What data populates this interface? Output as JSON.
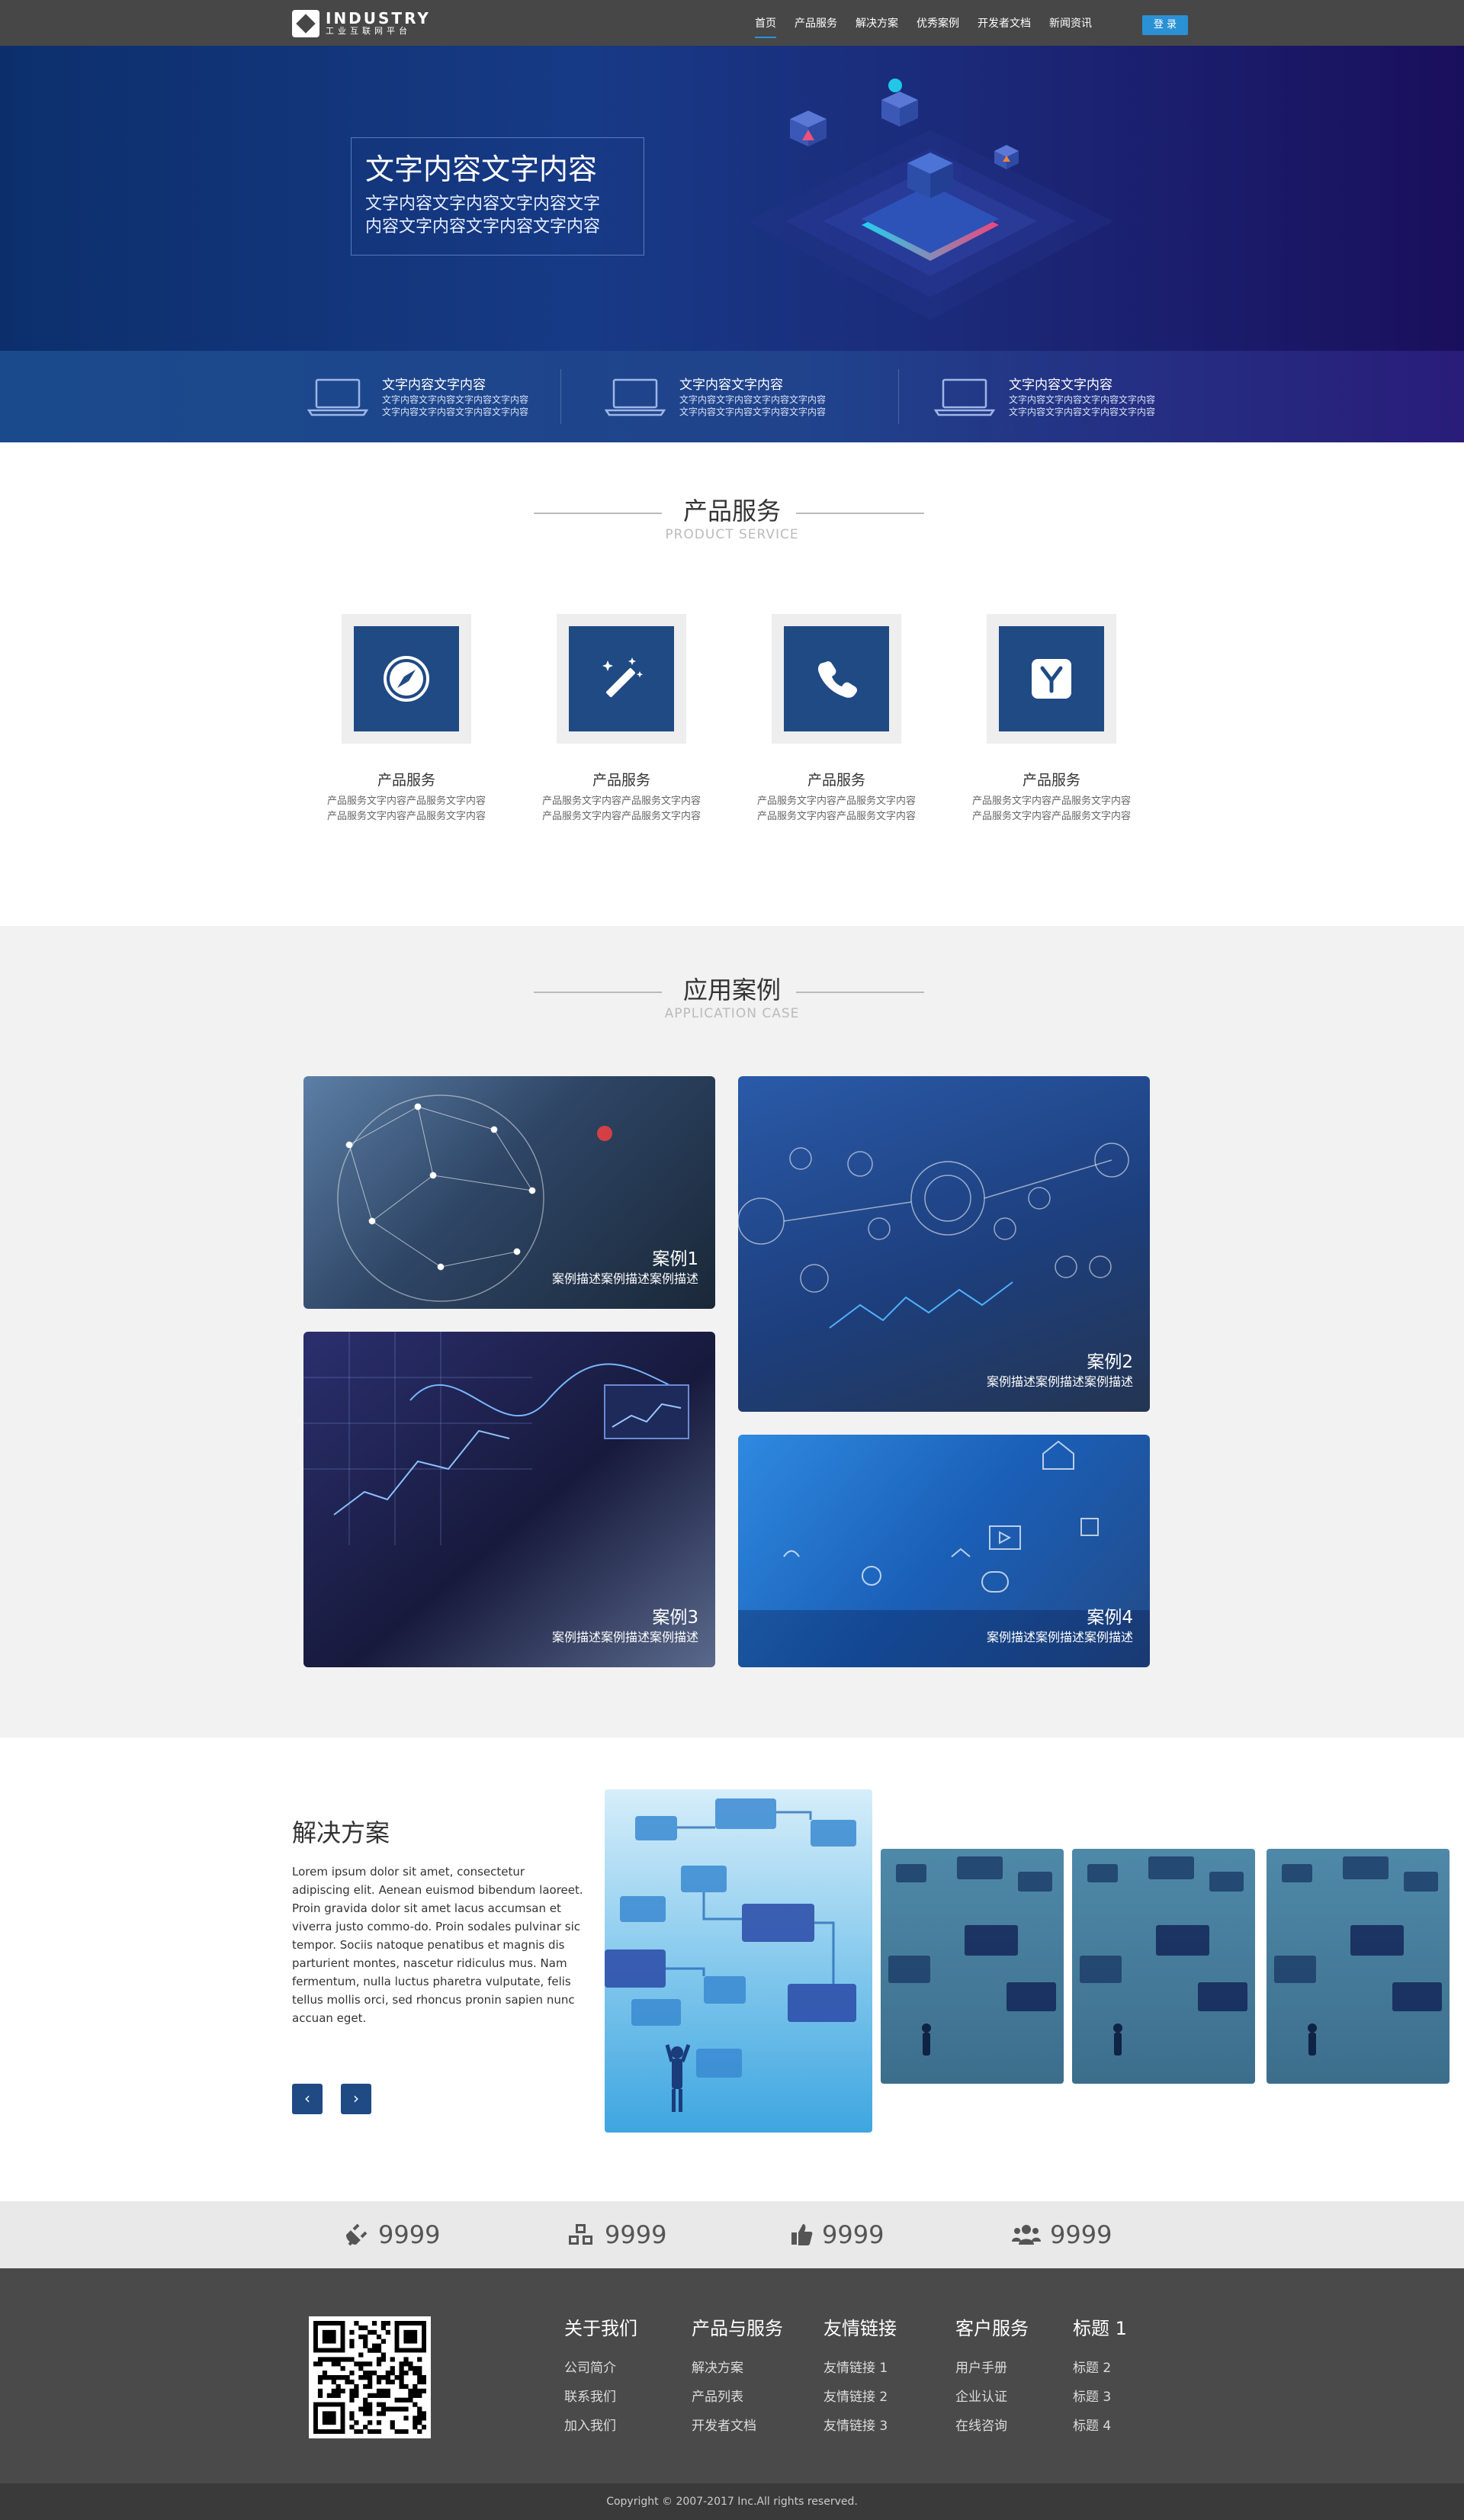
{
  "nav": {
    "logo_en": "INDUSTRY",
    "logo_cn": "工业互联网平台",
    "items": [
      "首页",
      "产品服务",
      "解决方案",
      "优秀案例",
      "开发者文档",
      "新闻资讯"
    ],
    "login": "登 录"
  },
  "hero": {
    "title": "文字内容文字内容",
    "line1": "文字内容文字内容文字内容文字",
    "line2": "内容文字内容文字内容文字内容",
    "features": [
      {
        "title": "文字内容文字内容",
        "desc1": "文字内容文字内容文字内容文字内容",
        "desc2": "文字内容文字内容文字内容文字内容"
      },
      {
        "title": "文字内容文字内容",
        "desc1": "文字内容文字内容文字内容文字内容",
        "desc2": "文字内容文字内容文字内容文字内容"
      },
      {
        "title": "文字内容文字内容",
        "desc1": "文字内容文字内容文字内容文字内容",
        "desc2": "文字内容文字内容文字内容文字内容"
      }
    ]
  },
  "products": {
    "title": "产品服务",
    "subtitle": "PRODUCT SERVICE",
    "items": [
      {
        "name": "产品服务",
        "d1": "产品服务文字内容产品服务文字内容",
        "d2": "产品服务文字内容产品服务文字内容"
      },
      {
        "name": "产品服务",
        "d1": "产品服务文字内容产品服务文字内容",
        "d2": "产品服务文字内容产品服务文字内容"
      },
      {
        "name": "产品服务",
        "d1": "产品服务文字内容产品服务文字内容",
        "d2": "产品服务文字内容产品服务文字内容"
      },
      {
        "name": "产品服务",
        "d1": "产品服务文字内容产品服务文字内容",
        "d2": "产品服务文字内容产品服务文字内容"
      }
    ]
  },
  "cases": {
    "title": "应用案例",
    "subtitle": "APPLICATION CASE",
    "items": [
      {
        "title": "案例1",
        "desc": "案例描述案例描述案例描述"
      },
      {
        "title": "案例2",
        "desc": "案例描述案例描述案例描述"
      },
      {
        "title": "案例3",
        "desc": "案例描述案例描述案例描述"
      },
      {
        "title": "案例4",
        "desc": "案例描述案例描述案例描述"
      }
    ]
  },
  "solution": {
    "title": "解决方案",
    "text": "Lorem ipsum dolor sit amet, consectetur adipiscing elit. Aenean euismod bibendum laoreet. Proin gravida dolor sit amet lacus accumsan et viverra justo commo-do. Proin sodales pulvinar sic tempor. Sociis natoque penatibus et magnis dis parturient montes, nascetur ridiculus mus. Nam fermentum, nulla luctus pharetra vulputate, felis tellus mollis orci, sed rhoncus pronin sapien nunc accuan eget.",
    "prev": "‹",
    "next": "›"
  },
  "stats": [
    "9999",
    "9999",
    "9999",
    "9999"
  ],
  "footer": {
    "columns": [
      {
        "title": "关于我们",
        "items": [
          "公司简介",
          "联系我们",
          "加入我们"
        ]
      },
      {
        "title": "产品与服务",
        "items": [
          "解决方案",
          "产品列表",
          "开发者文档"
        ]
      },
      {
        "title": "友情链接",
        "items": [
          "友情链接 1",
          "友情链接 2",
          "友情链接 3"
        ]
      },
      {
        "title": "客户服务",
        "items": [
          "用户手册",
          "企业认证",
          "在线咨询"
        ]
      },
      {
        "title": "标题 1",
        "items": [
          "标题 2",
          "标题 3",
          "标题 4"
        ]
      }
    ],
    "copyright": "Copyright © 2007-2017    Inc.All rights reserved."
  },
  "colors": {
    "nav": "#474747",
    "accent": "#2b91d5",
    "brand_blue": "#1f4a84",
    "footer": "#4a4a4a"
  }
}
